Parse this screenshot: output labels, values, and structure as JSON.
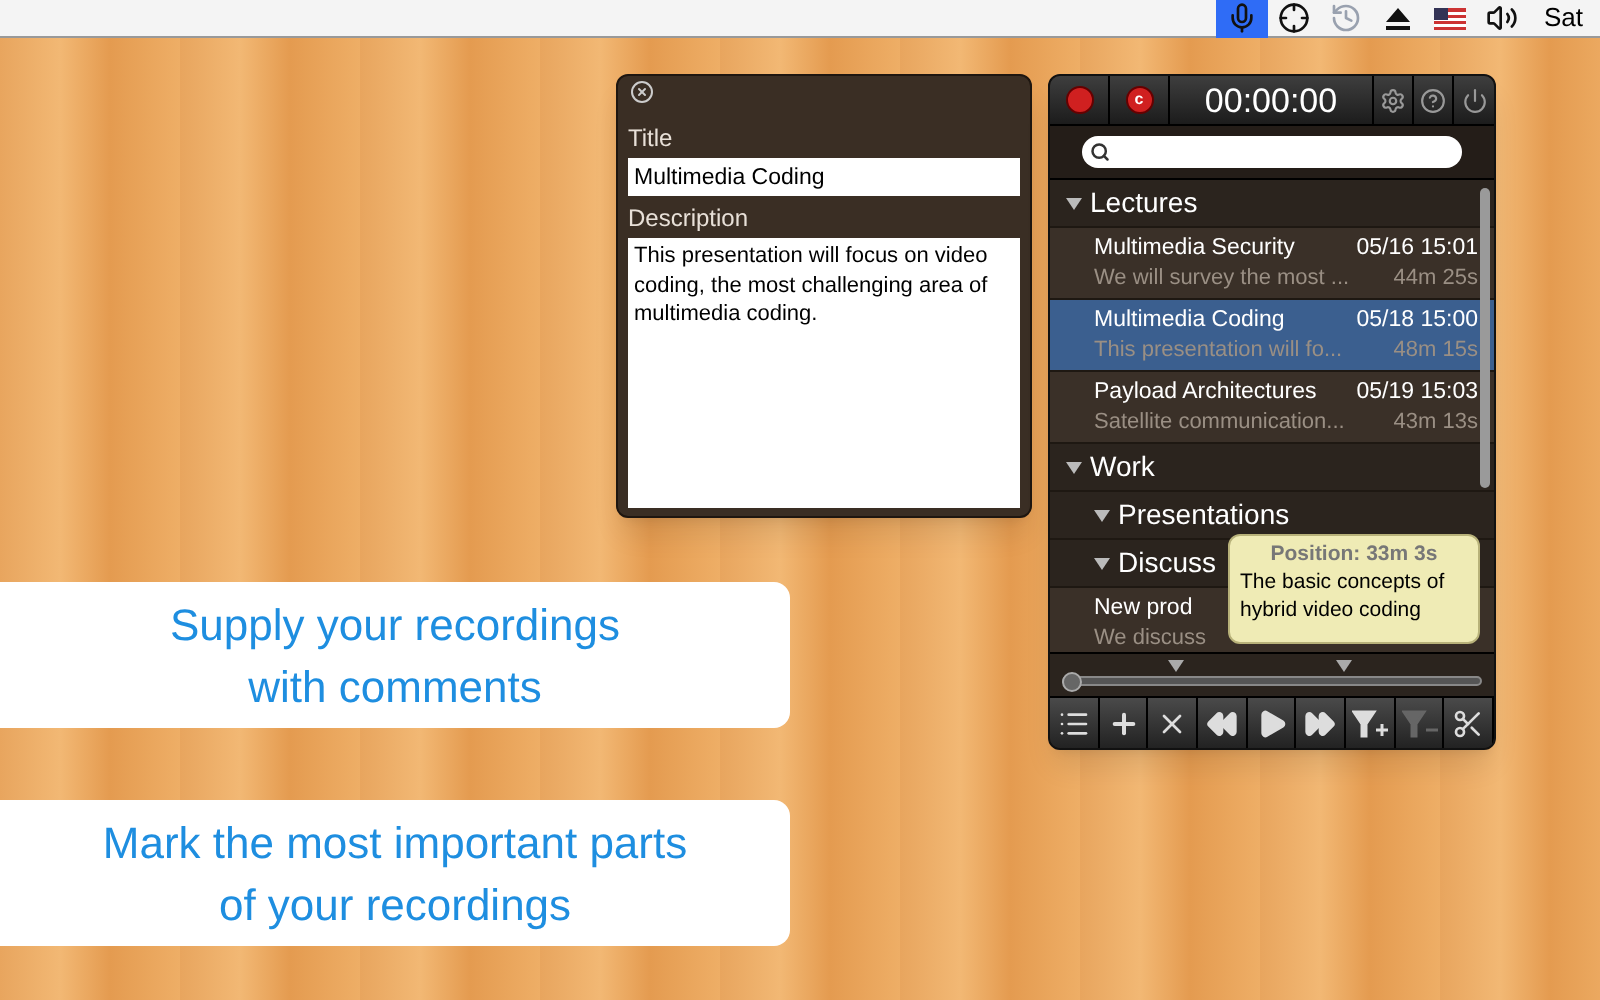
{
  "menu_bar": {
    "status_items": [
      {
        "kind": "microphone",
        "selected": true
      },
      {
        "kind": "crosshair",
        "selected": false
      },
      {
        "kind": "history",
        "selected": false
      },
      {
        "kind": "eject",
        "selected": false
      },
      {
        "kind": "flag",
        "selected": false
      },
      {
        "kind": "volume",
        "selected": false
      }
    ],
    "clock": "Sat"
  },
  "editor": {
    "title_label": "Title",
    "title_value": "Multimedia Coding",
    "description_label": "Description",
    "description_value": "This presentation will focus on video coding, the most challenging area of multimedia coding."
  },
  "recorder": {
    "record_badge": "c",
    "timer": "00:00:00",
    "tree": [
      {
        "label": "Lectures",
        "expanded": true,
        "items": [
          {
            "title": "Multimedia Security",
            "date": "05/16 15:01",
            "summary": "We will survey the most ...",
            "duration": "44m 25s",
            "selected": false
          },
          {
            "title": "Multimedia Coding",
            "date": "05/18 15:00",
            "summary": "This presentation will fo...",
            "duration": "48m 15s",
            "selected": true
          },
          {
            "title": "Payload Architectures",
            "date": "05/19 15:03",
            "summary": "Satellite communication...",
            "duration": "43m 13s",
            "selected": false
          }
        ]
      },
      {
        "label": "Work",
        "expanded": true,
        "children": [
          {
            "label": "Presentations",
            "expanded": true
          },
          {
            "label": "Discuss",
            "expanded": true,
            "items": [
              {
                "title": "New prod",
                "summary": "We discuss",
                "selected": false
              }
            ]
          }
        ]
      }
    ],
    "position": {
      "level": 0.0
    },
    "tooltip": {
      "heading": "Position: 33m 3s",
      "text": "The basic concepts of hybrid video coding"
    },
    "toolbar": [
      {
        "kind": "list",
        "disabled": false
      },
      {
        "kind": "add",
        "disabled": false
      },
      {
        "kind": "delete",
        "disabled": false
      },
      {
        "kind": "rewind",
        "disabled": false
      },
      {
        "kind": "play",
        "disabled": false
      },
      {
        "kind": "forward",
        "disabled": false
      },
      {
        "kind": "add-marker",
        "disabled": false
      },
      {
        "kind": "remove-marker",
        "disabled": true
      },
      {
        "kind": "cut",
        "disabled": false
      }
    ]
  },
  "callouts": [
    {
      "lines": [
        "Supply your recordings",
        "with comments"
      ]
    },
    {
      "lines": [
        "Mark the most important parts",
        "of your recordings"
      ]
    }
  ]
}
